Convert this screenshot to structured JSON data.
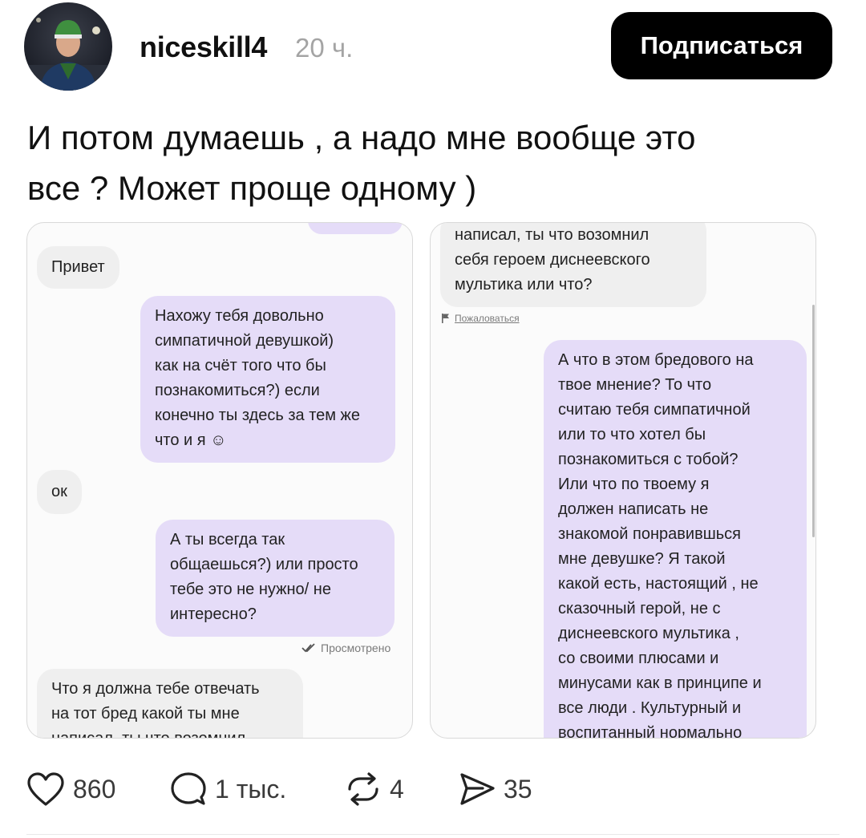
{
  "post": {
    "username": "niceskill4",
    "time": "20 ч.",
    "follow_label": "Подписаться",
    "text": "И потом думаешь , а надо мне вообще это\nвсе ? Может проще одному )"
  },
  "left_screenshot": {
    "msg_greeting": "Привет",
    "msg_compliment": "Нахожу тебя довольно\nсимпатичной девушкой)\nкак на счёт того что бы\nпознакомиться?) если\nконечно ты здесь за тем же\nчто и я ☺",
    "msg_ok": "ок",
    "msg_question": "А ты всегда так\nобщаешься?) или просто\nтебе это не нужно/ не\nинтересно?",
    "seen_label": "Просмотрено",
    "msg_reply": "Что я должна тебе отвечать\nна тот бред какой ты мне\nнаписал, ты что возомнил"
  },
  "right_screenshot": {
    "msg_reply_cont": "написал, ты что возомнил\nсебя героем диснеевского\nмультика или что?",
    "report_label": "Пожаловаться",
    "msg_long": "А что в этом бредового на\nтвое мнение? То что\nсчитаю тебя симпатичной\nили то что хотел бы\nпознакомиться с тобой?\nИли что по твоему я\nдолжен написать не\nзнакомой понравившься\nмне девушке? Я такой\nкакой есть, настоящий , не\nсказочный герой, не с\nдиснеевского мультика ,\nсо своими плюсами и\nминусами как в принципе и\nвсе люди . Культурный и\nвоспитанный нормально"
  },
  "actions": {
    "likes": "860",
    "comments": "1 тыс.",
    "reposts": "4",
    "shares": "35"
  },
  "colors": {
    "incoming_bubble": "#efefef",
    "outgoing_bubble": "#e5dcf8",
    "button_bg": "#000000"
  },
  "icons": [
    "heart-icon",
    "comment-icon",
    "repost-icon",
    "share-icon",
    "double-check-icon",
    "flag-icon"
  ]
}
